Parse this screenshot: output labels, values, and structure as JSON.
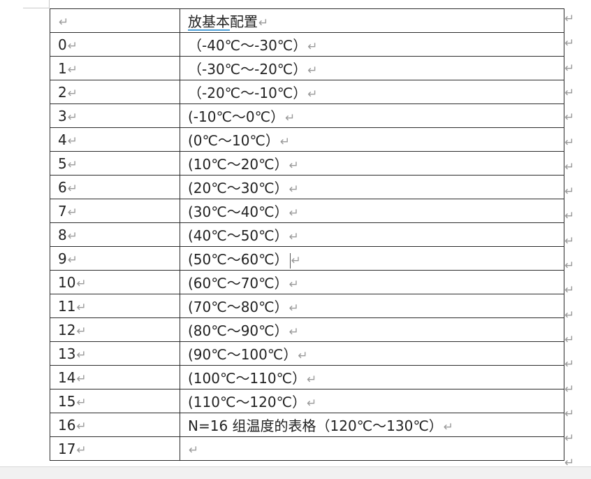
{
  "mark": "↵",
  "header": {
    "col1": "",
    "col2_underlined": "放基本",
    "col2_rest": "配置"
  },
  "rows": [
    {
      "idx": "0",
      "range": "（-40℃～-30℃）"
    },
    {
      "idx": "1",
      "range": "（-30℃～-20℃）"
    },
    {
      "idx": "2",
      "range": "（-20℃～-10℃）"
    },
    {
      "idx": "3",
      "range": "(-10℃～0℃）"
    },
    {
      "idx": "4",
      "range": "(0℃～10℃）"
    },
    {
      "idx": "5",
      "range": "(10℃～20℃）"
    },
    {
      "idx": "6",
      "range": "(20℃～30℃）"
    },
    {
      "idx": "7",
      "range": "(30℃～40℃）"
    },
    {
      "idx": "8",
      "range": "(40℃～50℃）"
    },
    {
      "idx": "9",
      "range": "(50℃～60℃）"
    },
    {
      "idx": "10",
      "range": "(60℃～70℃）"
    },
    {
      "idx": "11",
      "range": "(70℃～80℃）"
    },
    {
      "idx": "12",
      "range": "(80℃～90℃）"
    },
    {
      "idx": "13",
      "range": "(90℃～100℃）"
    },
    {
      "idx": "14",
      "range": "(100℃～110℃）"
    },
    {
      "idx": "15",
      "range": "(110℃～120℃）"
    },
    {
      "idx": "16",
      "range": "N=16 组温度的表格（120℃～130℃）"
    },
    {
      "idx": "17",
      "range": ""
    }
  ]
}
